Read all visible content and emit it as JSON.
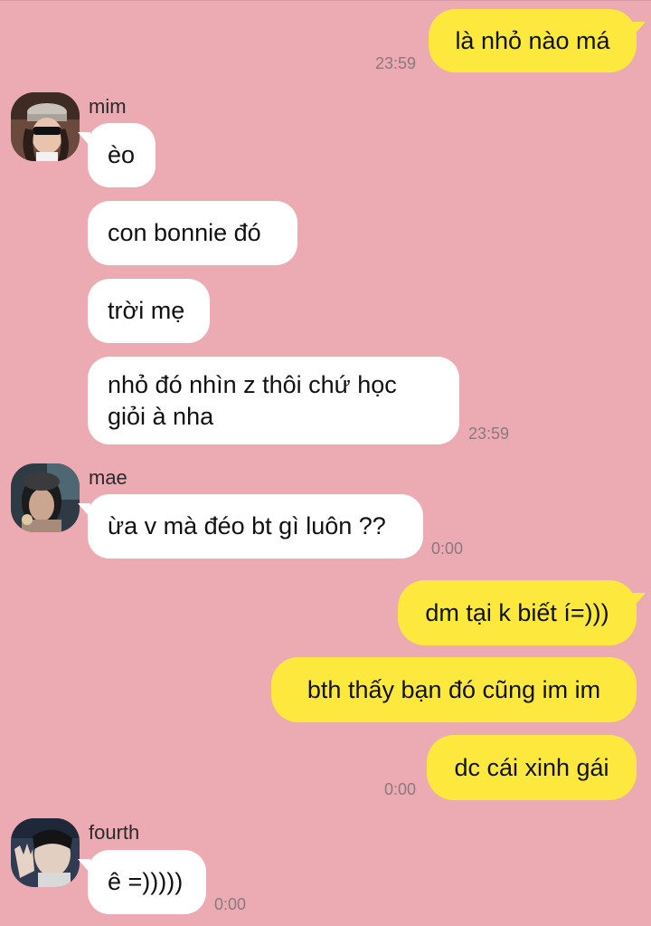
{
  "messages": {
    "m1": {
      "text": "là nhỏ nào má",
      "time": "23:59"
    },
    "mim": {
      "name": "mim",
      "b1": "èo",
      "b2": "con bonnie đó",
      "b3": "trời mẹ",
      "b4": "nhỏ đó nhìn z thôi chứ học giỏi à nha",
      "time": "23:59"
    },
    "mae": {
      "name": "mae",
      "b1": "ừa v mà đéo bt gì luôn ??",
      "time": "0:00"
    },
    "me2": {
      "b1": "dm tại k biết í=)))",
      "b2": "bth thấy bạn đó cũng im im",
      "b3": "dc cái xinh gái",
      "time": "0:00"
    },
    "fourth": {
      "name": "fourth",
      "b1": "ê =)))))",
      "time": "0:00"
    }
  },
  "colors": {
    "background": "#ecaab3",
    "outgoing_bubble": "#fde93d",
    "incoming_bubble": "#ffffff",
    "timestamp": "#8a7a7d"
  },
  "icons": {
    "mim": "avatar-mim-photo",
    "mae": "avatar-mae-photo",
    "fourth": "avatar-fourth-photo"
  }
}
